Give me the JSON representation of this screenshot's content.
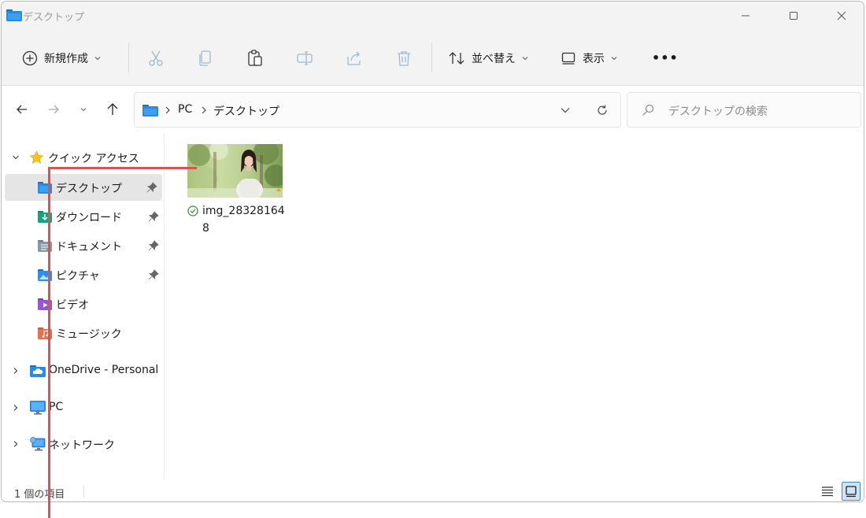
{
  "window": {
    "title": "デスクトップ"
  },
  "toolbar": {
    "new_label": "新規作成",
    "sort_label": "並べ替え",
    "view_label": "表示",
    "more_label": "•••"
  },
  "address": {
    "segments": [
      "PC",
      "デスクトップ"
    ]
  },
  "search": {
    "placeholder": "デスクトップの検索"
  },
  "sidebar": {
    "quick_access": "クイック アクセス",
    "items": [
      {
        "label": "デスクトップ",
        "icon": "desktop-folder-icon",
        "pinned": true,
        "selected": true
      },
      {
        "label": "ダウンロード",
        "icon": "downloads-folder-icon",
        "pinned": true
      },
      {
        "label": "ドキュメント",
        "icon": "documents-folder-icon",
        "pinned": true
      },
      {
        "label": "ピクチャ",
        "icon": "pictures-folder-icon",
        "pinned": true
      },
      {
        "label": "ビデオ",
        "icon": "videos-folder-icon",
        "pinned": false
      },
      {
        "label": "ミュージック",
        "icon": "music-folder-icon",
        "pinned": false
      }
    ],
    "onedrive": "OneDrive - Personal",
    "pc": "PC",
    "network": "ネットワーク"
  },
  "files": [
    {
      "name_line1": "img_28328164",
      "name_line2": "8",
      "status": "synced"
    }
  ],
  "status": {
    "count_text": "1 個の項目"
  },
  "colors": {
    "accent": "#0078d4",
    "callout": "#e05050",
    "selection": "#e5e5e5"
  }
}
